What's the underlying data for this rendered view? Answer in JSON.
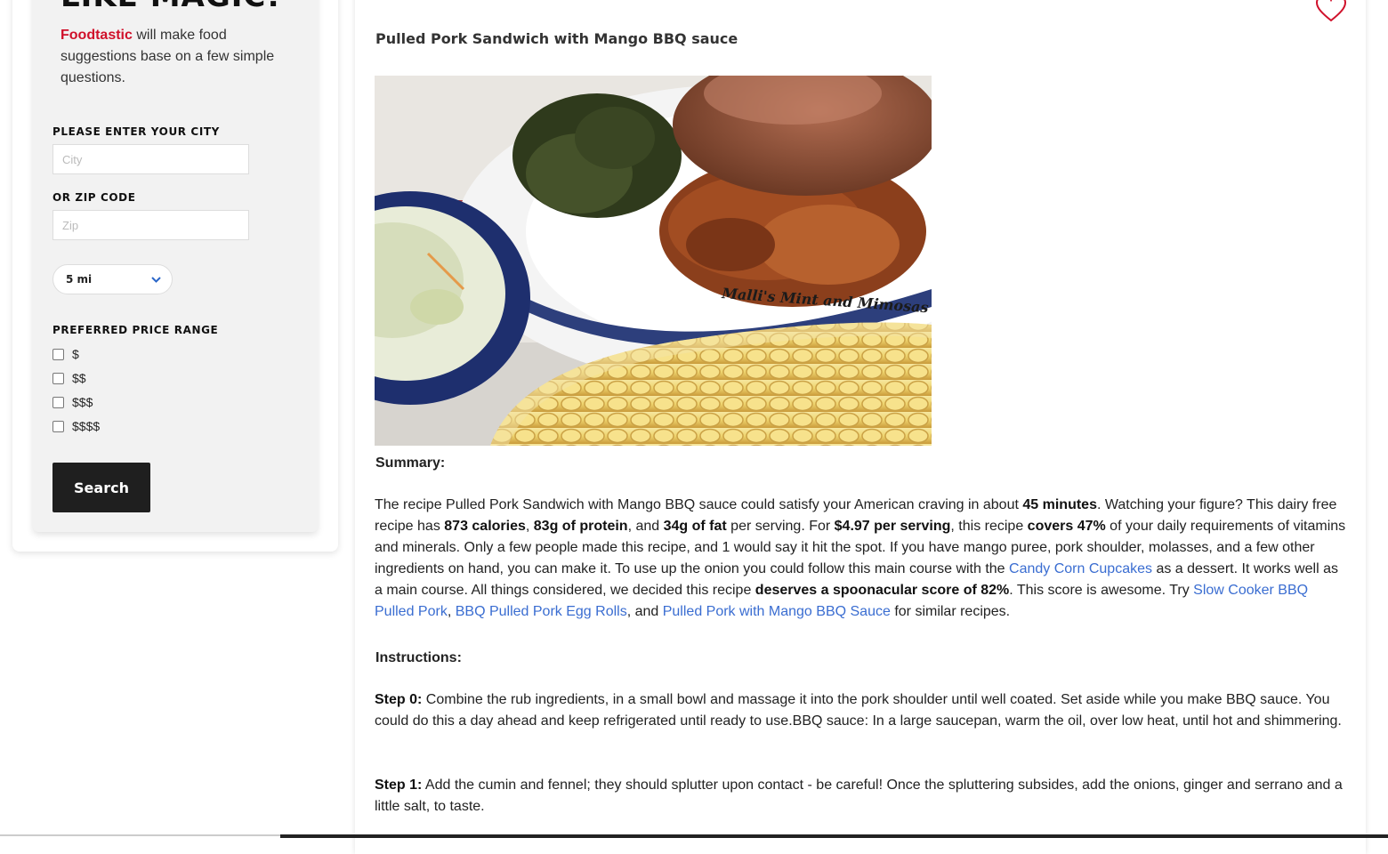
{
  "sidebar": {
    "heading": "LIKE MAGIC!",
    "brand": "Foodtastic",
    "intro_rest": " will make food suggestions base on a few simple questions.",
    "city_label": "PLEASE ENTER YOUR CITY",
    "city_placeholder": "City",
    "zip_label": "OR ZIP CODE",
    "zip_placeholder": "Zip",
    "distance_value": "5 mi",
    "price_label": "PREFERRED PRICE RANGE",
    "price_options": [
      "$",
      "$$",
      "$$$",
      "$$$$"
    ],
    "search_label": "Search"
  },
  "recipe": {
    "title": "Pulled Pork Sandwich with Mango BBQ sauce",
    "photo_watermark": "Malli's Mint and Mimosas",
    "summary_label": "Summary:",
    "summary": {
      "s1": "The recipe Pulled Pork Sandwich with Mango BBQ sauce could satisfy your American craving in about ",
      "b1": "45 minutes",
      "s2": ". Watching your figure? This dairy free recipe has ",
      "b2": "873 calories",
      "s3": ", ",
      "b3": "83g of protein",
      "s4": ", and ",
      "b4": "34g of fat",
      "s5": " per serving. For ",
      "b5": "$4.97 per serving",
      "s6": ", this recipe ",
      "b6": "covers 47%",
      "s7": " of your daily requirements of vitamins and minerals. Only a few people made this recipe, and 1 would say it hit the spot. If you have mango puree, pork shoulder, molasses, and a few other ingredients on hand, you can make it. To use up the onion you could follow this main course with the ",
      "l1": "Candy Corn Cupcakes",
      "s8": " as a dessert. It works well as a main course. All things considered, we decided this recipe ",
      "b7": "deserves a spoonacular score of 82%",
      "s9": ". This score is awesome. Try ",
      "l2": "Slow Cooker BBQ Pulled Pork",
      "s10": ", ",
      "l3": "BBQ Pulled Pork Egg Rolls",
      "s11": ", and ",
      "l4": "Pulled Pork with Mango BBQ Sauce",
      "s12": " for similar recipes."
    },
    "instructions_label": "Instructions:",
    "steps": [
      {
        "label": "Step 0:",
        "text": " Combine the rub ingredients, in a small bowl and massage it into the pork shoulder until well coated. Set aside while you make BBQ sauce. You could do this a day ahead and keep refrigerated until ready to use.BBQ sauce: In a large saucepan, warm the oil, over low heat, until hot and shimmering."
      },
      {
        "label": "Step 1:",
        "text": " Add the cumin and fennel; they should splutter upon contact - be careful! Once the spluttering subsides, add the onions, ginger and serrano and a little salt, to taste."
      }
    ]
  },
  "colors": {
    "brand": "#d0112b",
    "link": "#3a6dd1",
    "button": "#1f1f1f"
  }
}
